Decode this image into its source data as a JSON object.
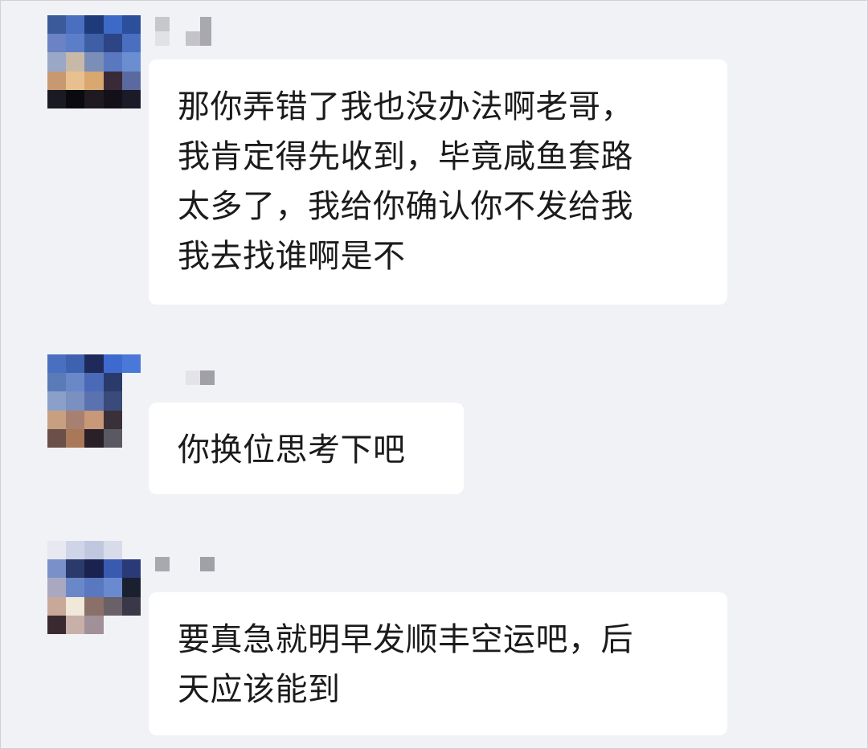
{
  "messages": [
    {
      "text": "那你弄错了我也没办法啊老哥，\n我肯定得先收到，毕竟咸鱼套路\n太多了，我给你确认你不发给我\n我去找谁啊是不"
    },
    {
      "text": "你换位思考下吧"
    },
    {
      "text": "要真急就明早发顺丰空运吧，后\n天应该能到"
    }
  ],
  "colors": {
    "background": "#f1f2f6",
    "bubble": "#ffffff",
    "text": "#1b1b1b"
  }
}
